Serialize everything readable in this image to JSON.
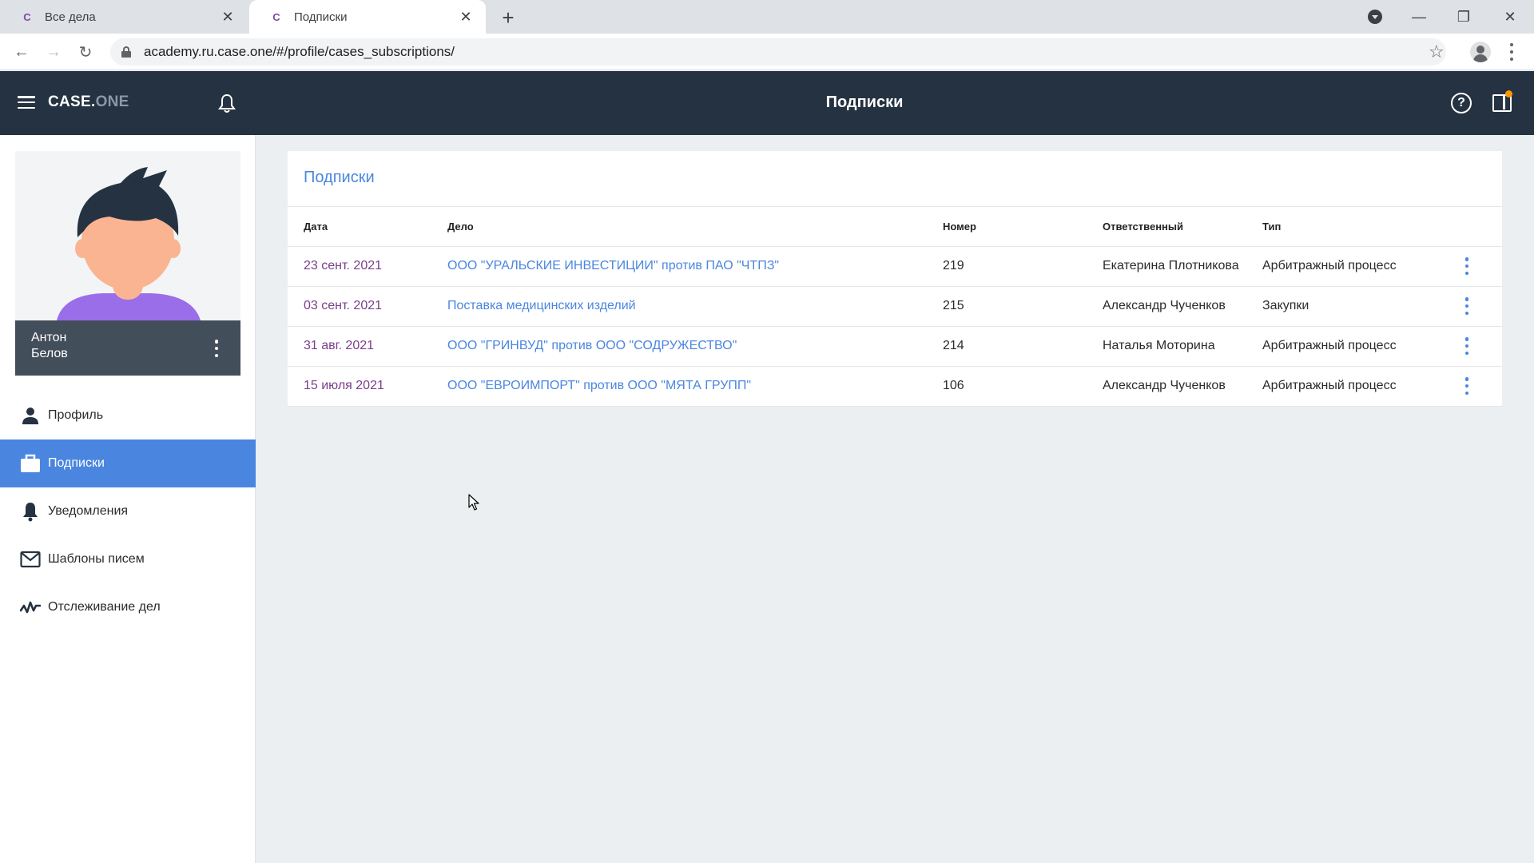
{
  "browser": {
    "tabs": [
      {
        "title": "Все дела",
        "favicon": "C"
      },
      {
        "title": "Подписки",
        "favicon": "C"
      }
    ],
    "url": "academy.ru.case.one/#/profile/cases_subscriptions/"
  },
  "appbar": {
    "logo_main": "CASE.",
    "logo_sub": "ONE",
    "title": "Подписки"
  },
  "user": {
    "first_name": "Антон",
    "last_name": "Белов"
  },
  "nav": {
    "items": [
      {
        "label": "Профиль",
        "icon": "person-icon",
        "active": false
      },
      {
        "label": "Подписки",
        "icon": "briefcase-icon",
        "active": true
      },
      {
        "label": "Уведомления",
        "icon": "bell-icon",
        "active": false
      },
      {
        "label": "Шаблоны писем",
        "icon": "mail-icon",
        "active": false
      },
      {
        "label": "Отслеживание дел",
        "icon": "activity-icon",
        "active": false
      }
    ]
  },
  "subscriptions": {
    "title": "Подписки",
    "columns": {
      "date": "Дата",
      "case": "Дело",
      "number": "Номер",
      "responsible": "Ответственный",
      "type": "Тип"
    },
    "rows": [
      {
        "date": "23 сент. 2021",
        "case": "ООО \"УРАЛЬСКИЕ ИНВЕСТИЦИИ\" против ПАО \"ЧТПЗ\"",
        "number": "219",
        "responsible": "Екатерина Плотникова",
        "type": "Арбитражный процесс"
      },
      {
        "date": "03 сент. 2021",
        "case": "Поставка медицинских изделий",
        "number": "215",
        "responsible": "Александр Чученков",
        "type": "Закупки"
      },
      {
        "date": "31 авг. 2021",
        "case": "ООО \"ГРИНВУД\" против ООО \"СОДРУЖЕСТВО\"",
        "number": "214",
        "responsible": "Наталья Моторина",
        "type": "Арбитражный процесс"
      },
      {
        "date": "15 июля 2021",
        "case": "ООО \"ЕВРОИМПОРТ\" против ООО \"МЯТА ГРУПП\"",
        "number": "106",
        "responsible": "Александр Чученков",
        "type": "Арбитражный процесс"
      }
    ]
  },
  "colors": {
    "appbar": "#253241",
    "accent": "#4a86e0",
    "date_text": "#7b3d8c",
    "notification_dot": "#ff9800"
  }
}
